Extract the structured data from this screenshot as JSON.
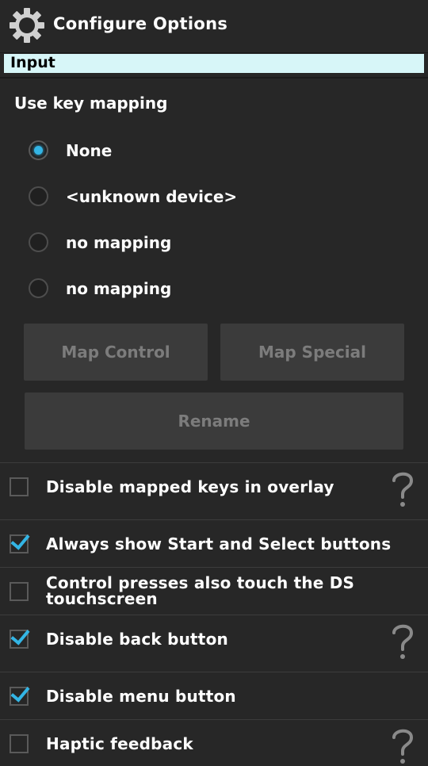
{
  "titlebar": {
    "title": "Configure Options",
    "icon": "gear-icon"
  },
  "section": {
    "header": "Input"
  },
  "keymap": {
    "label": "Use key mapping",
    "options": [
      {
        "label": "None",
        "selected": true
      },
      {
        "label": "<unknown device>",
        "selected": false
      },
      {
        "label": "no mapping",
        "selected": false
      },
      {
        "label": "no mapping",
        "selected": false
      }
    ]
  },
  "buttons": {
    "map_control": "Map Control",
    "map_special": "Map Special",
    "rename": "Rename"
  },
  "settings": [
    {
      "label": "Disable mapped keys in overlay",
      "checked": false,
      "help": true
    },
    {
      "label": "Always show Start and Select buttons",
      "checked": true,
      "help": false
    },
    {
      "label": "Control presses also touch the DS touchscreen",
      "checked": false,
      "help": false
    },
    {
      "label": "Disable back button",
      "checked": true,
      "help": true
    },
    {
      "label": "Disable menu button",
      "checked": true,
      "help": false
    },
    {
      "label": "Haptic feedback",
      "checked": false,
      "help": true
    }
  ],
  "colors": {
    "accent": "#33b5e5",
    "header_bg": "#d7f6f8",
    "background": "#272727",
    "button_bg": "#3b3b3b"
  }
}
